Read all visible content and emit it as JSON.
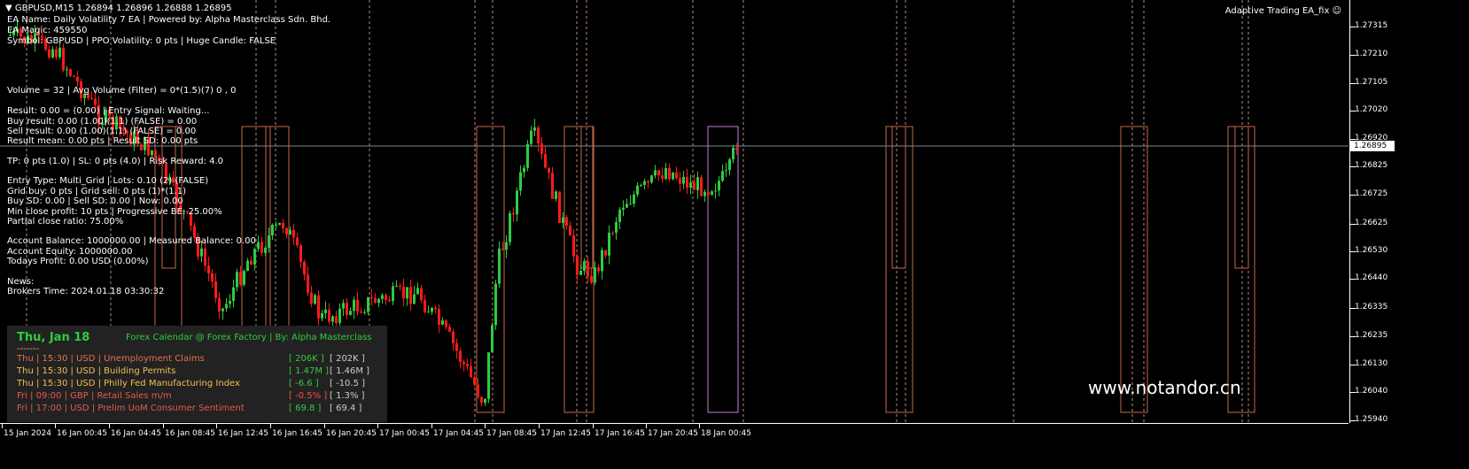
{
  "header": {
    "symbol_line": "GBPUSD,M15  1.26894 1.26896 1.26888 1.26895",
    "ea_title": "Adaptive Trading EA_fix"
  },
  "info_lines": [
    "EA Name: Daily Volatility 7 EA | Powered by: Alpha Masterclass Sdn. Bhd.",
    "EA Magic: 459550",
    "Symbol: GBPUSD | PPO Volatility: 0 pts | Huge Candle: FALSE",
    "Volume = 32 | Avg Volume (Filter) = 0*(1.5)(7) 0 , 0",
    "Result: 0.00 = (0.00) | Entry Signal: Waiting...",
    "Buy result: 0.00 (1.00)(1.1) (FALSE) = 0.00",
    "Sell result: 0.00 (1.00)(1.1) (FALSE) = 0.00",
    "Result mean: 0.00 pts | Result SD: 0.00 pts",
    "TP: 0 pts (1.0) | SL: 0 pts (4.0) | Risk Reward: 4.0",
    "Entry Type: Multi_Grid | Lots: 0.10 (2) (FALSE)",
    "Grid buy: 0 pts | Grid sell: 0 pts (1)*(1.1)",
    "Buy SD: 0.00 | Sell SD: 0.00 | Now: 0.00",
    "Min close profit: 10 pts | Progressive BE: 25.00%",
    "Partial close ratio: 75.00%",
    "Account Balance: 1000000.00 | Measured Balance: 0.00",
    "Account Equity: 1000000.00",
    "Todays Profit: 0.00 USD (0.00%)",
    "News:",
    "Brokers Time: 2024.01.18 03:30:32"
  ],
  "price_axis": {
    "labels": [
      "1.27315",
      "1.27210",
      "1.27105",
      "1.27020",
      "1.26920",
      "1.26825",
      "1.26725",
      "1.26625",
      "1.26530",
      "1.26440",
      "1.26335",
      "1.26235",
      "1.26130",
      "1.26040",
      "1.25940"
    ],
    "current": "1.26895"
  },
  "time_axis": {
    "labels": [
      "15 Jan 2024",
      "16 Jan 00:45",
      "16 Jan 04:45",
      "16 Jan 08:45",
      "16 Jan 12:45",
      "16 Jan 16:45",
      "16 Jan 20:45",
      "17 Jan 00:45",
      "17 Jan 04:45",
      "17 Jan 08:45",
      "17 Jan 12:45",
      "17 Jan 16:45",
      "17 Jan 20:45",
      "18 Jan 00:45"
    ]
  },
  "calendar": {
    "date": "Thu, Jan 18",
    "title": "Forex Calendar @ Forex Factory | By: Alpha Masterclass",
    "separator": "-------",
    "events": [
      {
        "text": "Thu  |  15:30  |  USD  |  Unemployment Claims",
        "forecast": "[ 206K ]",
        "previous": "[ 202K ]",
        "color": "#e8724a"
      },
      {
        "text": "Thu  |  15:30  |  USD  |  Building Permits",
        "forecast": "[ 1.47M ]",
        "previous": "[ 1.46M ]",
        "color": "#f0c050"
      },
      {
        "text": "Thu  |  15:30  |  USD  |  Philly Fed Manufacturing Index",
        "forecast": "[ -6.6 ]",
        "previous": "[ -10.5 ]",
        "color": "#f0c050"
      },
      {
        "text": "Fri  |  09:00  |  GBP  |  Retail Sales m/m",
        "forecast": "[ -0.5% ]",
        "previous": "[ 1.3% ]",
        "color": "#e85a4a"
      },
      {
        "text": "Fri  |  17:00  |  USD  |  Prelim UoM Consumer Sentiment",
        "forecast": "[ 69.8 ]",
        "previous": "[ 69.4 ]",
        "color": "#e85a4a"
      }
    ],
    "forecast_colors": [
      "#2ecc40",
      "#2ecc40",
      "#2ecc40",
      "#ff4a3a",
      "#2ecc40"
    ]
  },
  "watermark": "www.notandor.cn",
  "colors": {
    "bull": "#2ecc40",
    "bear": "#ff1a1a",
    "orange_box": "#c8664a",
    "violet_box": "#c080e0",
    "session_line": "#f0c0a0",
    "current_price_line": "#7a8a9a"
  }
}
